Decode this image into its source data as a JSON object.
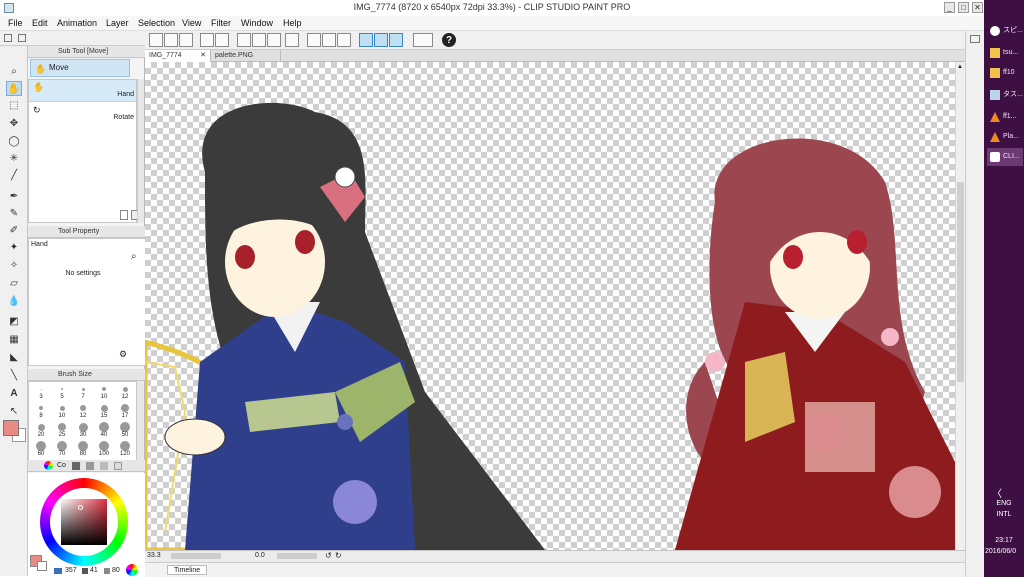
{
  "window": {
    "title": "IMG_7774 (8720 x 6540px 72dpi 33.3%) - CLIP STUDIO PAINT PRO",
    "controls": [
      "_",
      "□",
      "✕"
    ]
  },
  "menu": [
    "File",
    "Edit",
    "Animation",
    "Layer",
    "Selection",
    "View",
    "Filter",
    "Window",
    "Help"
  ],
  "tabs": [
    {
      "label": "IMG_7774",
      "active": true
    },
    {
      "label": "palette.PNG",
      "active": false
    }
  ],
  "subtool_panel": {
    "title": "Sub Tool [Move]",
    "group": "Move",
    "items": [
      "Hand",
      "Rotate"
    ]
  },
  "tool_property": {
    "title": "Tool Property",
    "tool": "Hand",
    "message": "No settings"
  },
  "brush_size": {
    "title": "Brush Size",
    "rows": [
      [
        "3",
        "5",
        "7",
        "10",
        "12"
      ],
      [
        "8",
        "10",
        "12",
        "15",
        "17"
      ],
      [
        "20",
        "25",
        "30",
        "40",
        "50"
      ],
      [
        "60",
        "70",
        "80",
        "100",
        "120"
      ]
    ]
  },
  "color_panel": {
    "tab": "Co",
    "h": "357",
    "s": "41",
    "v": "80"
  },
  "status": {
    "zoom": "33.3",
    "angle": "0.0"
  },
  "timeline": {
    "label": "Timeline"
  },
  "taskbar": {
    "items": [
      {
        "label": "スピ..."
      },
      {
        "label": "tsu..."
      },
      {
        "label": "ff10"
      },
      {
        "label": "タス..."
      },
      {
        "label": "ff1..."
      },
      {
        "label": "Pla..."
      },
      {
        "label": "CLI...",
        "active": true
      }
    ],
    "chevron": "〈",
    "lang": "ENG",
    "layout": "INTL",
    "time": "23:17",
    "date": "2016/06/0"
  },
  "colors": {
    "main_color": "#e98a84",
    "taskbar_bg": "#3d0f43",
    "left_kimono": "#2c3f8e",
    "right_kimono": "#8e1b1e",
    "right_hair": "#9c464f",
    "left_hair": "#3b3b3b"
  }
}
